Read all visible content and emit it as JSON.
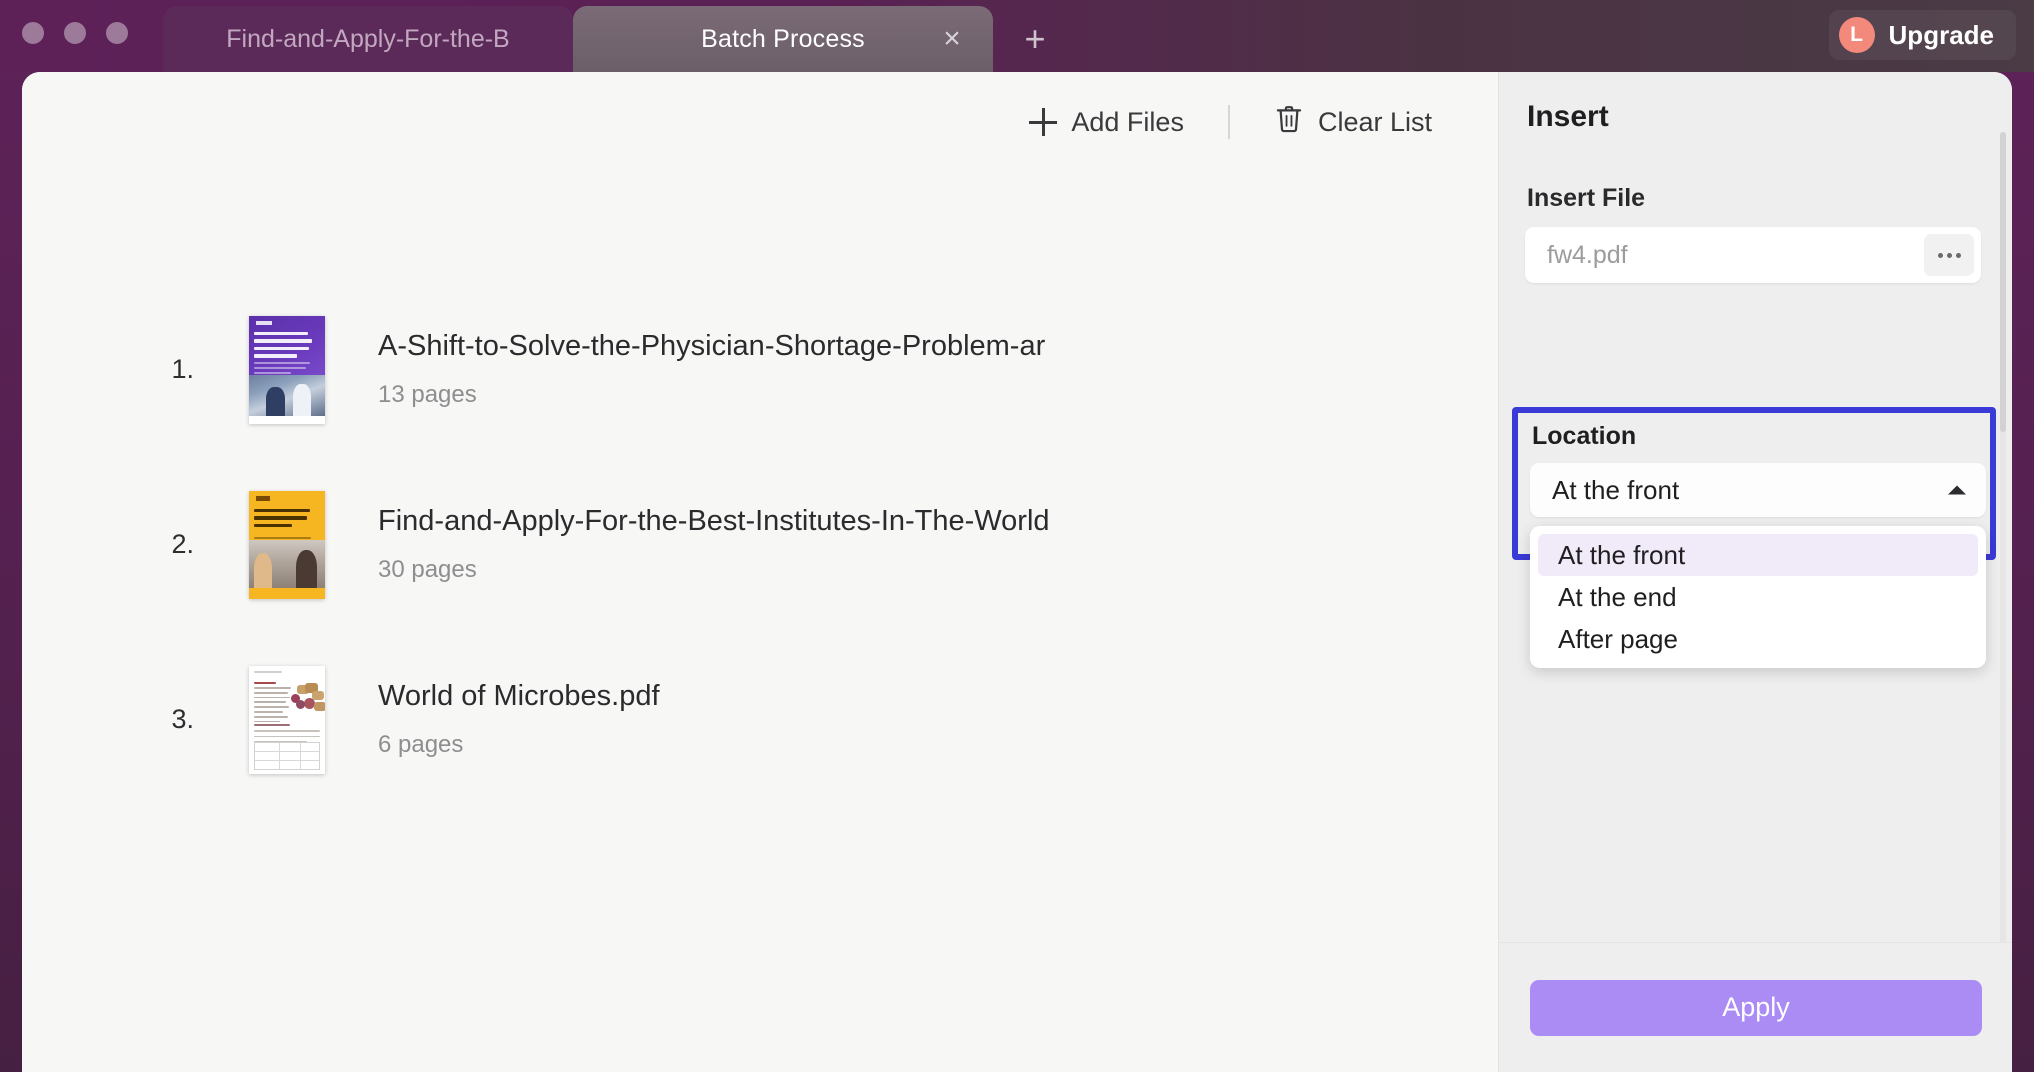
{
  "window": {
    "traffic_lights": [
      "close",
      "minimize",
      "maximize"
    ],
    "tabs": [
      {
        "title": "Find-and-Apply-For-the-B",
        "active": false
      },
      {
        "title": "Batch Process",
        "active": true
      }
    ],
    "close_tab_icon": "×",
    "new_tab_icon": "+",
    "upgrade": {
      "avatar_letter": "L",
      "label": "Upgrade"
    }
  },
  "toolbar": {
    "add_files_label": "Add Files",
    "clear_list_label": "Clear List"
  },
  "file_list": [
    {
      "index": "1.",
      "name": "A-Shift-to-Solve-the-Physician-Shortage-Problem-ar",
      "pages": "13 pages"
    },
    {
      "index": "2.",
      "name": "Find-and-Apply-For-the-Best-Institutes-In-The-World",
      "pages": "30 pages"
    },
    {
      "index": "3.",
      "name": "World of Microbes.pdf",
      "pages": "6 pages"
    }
  ],
  "panel": {
    "title": "Insert",
    "insert_file_label": "Insert File",
    "insert_file_value": "",
    "insert_file_placeholder": "fw4.pdf",
    "location_label": "Location",
    "location_selected": "At the front",
    "location_options": [
      {
        "label": "At the front",
        "selected": true
      },
      {
        "label": "At the end",
        "selected": false
      },
      {
        "label": "After page",
        "selected": false
      }
    ],
    "apply_label": "Apply"
  },
  "colors": {
    "window_chrome": "#5b2157",
    "content_bg": "#f7f7f6",
    "panel_bg": "#eeeeee",
    "highlight_border": "#3a3ad6",
    "apply_button": "#ab8cf5",
    "option_selected_bg": "#f0eaf9",
    "upgrade_avatar": "#f2897b"
  }
}
